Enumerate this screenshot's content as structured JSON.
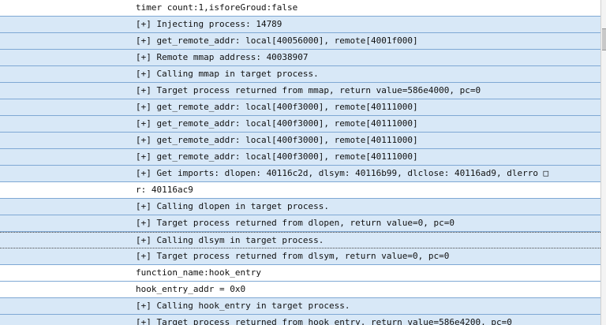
{
  "log": {
    "rows": [
      "timer count:1,isforeGroud:false",
      "[+] Injecting process: 14789",
      "[+] get_remote_addr: local[40056000], remote[4001f000]",
      "[+] Remote mmap address: 40038907",
      "[+] Calling mmap in target process.",
      "[+] Target process returned from mmap, return value=586e4000, pc=0",
      "[+] get_remote_addr: local[400f3000], remote[40111000]",
      "[+] get_remote_addr: local[400f3000], remote[40111000]",
      "[+] get_remote_addr: local[400f3000], remote[40111000]",
      "[+] get_remote_addr: local[400f3000], remote[40111000]",
      "[+] Get imports: dlopen: 40116c2d, dlsym: 40116b99, dlclose: 40116ad9, dlerro □",
      "r: 40116ac9",
      "[+] Calling dlopen in target process.",
      "[+] Target process returned from dlopen, return value=0, pc=0",
      "[+] Calling dlsym in target process.",
      "[+] Target process returned from dlsym, return value=0, pc=0",
      "function_name:hook_entry",
      "hook_entry_addr = 0x0",
      "[+] Calling hook_entry in target process.",
      "[+] Target process returned from hook_entry, return value=586e4200, pc=0"
    ]
  }
}
